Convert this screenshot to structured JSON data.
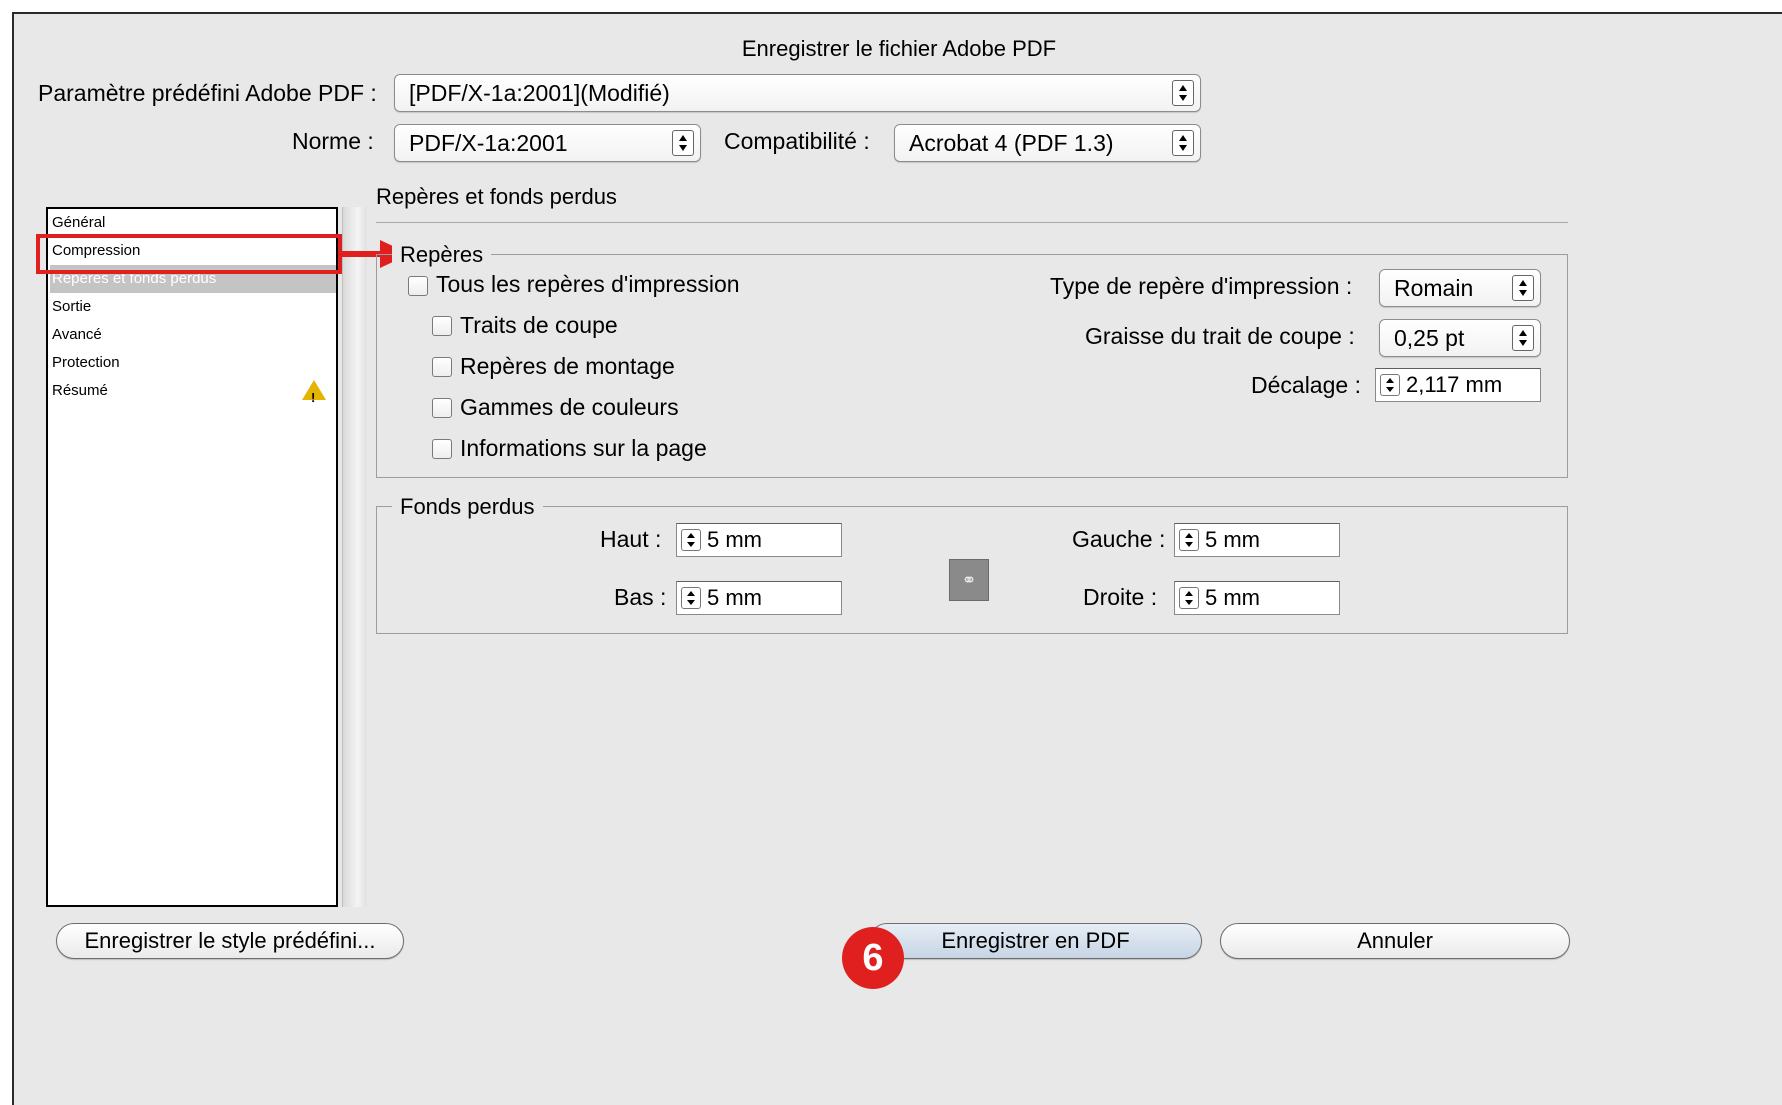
{
  "dialog": {
    "title": "Enregistrer le fichier Adobe PDF"
  },
  "preset": {
    "label": "Paramètre prédéfini Adobe PDF :",
    "value": "[PDF/X-1a:2001](Modifié)"
  },
  "standard": {
    "label": "Norme :",
    "value": "PDF/X-1a:2001"
  },
  "compatibility": {
    "label": "Compatibilité :",
    "value": "Acrobat 4 (PDF 1.3)"
  },
  "sidebar": {
    "items": [
      {
        "label": "Général"
      },
      {
        "label": "Compression"
      },
      {
        "label": "Repères et fonds perdus",
        "selected": true
      },
      {
        "label": "Sortie"
      },
      {
        "label": "Avancé"
      },
      {
        "label": "Protection"
      },
      {
        "label": "Résumé",
        "warning_icon": "warning-triangle-icon"
      }
    ]
  },
  "panel": {
    "title": "Repères et fonds perdus"
  },
  "marks": {
    "group_title": "Repères",
    "all_marks": {
      "label": "Tous les repères d'impression",
      "checked": false
    },
    "options": [
      {
        "label": "Traits de coupe",
        "checked": false
      },
      {
        "label": "Repères de montage",
        "checked": false
      },
      {
        "label": "Gammes de couleurs",
        "checked": false
      },
      {
        "label": "Informations sur la page",
        "checked": false
      }
    ],
    "type_label": "Type de repère d'impression :",
    "type_value": "Romain",
    "weight_label": "Graisse du trait de coupe :",
    "weight_value": "0,25 pt",
    "offset_label": "Décalage :",
    "offset_value": "2,117 mm"
  },
  "bleed": {
    "group_title": "Fonds perdus",
    "top_label": "Haut :",
    "top_value": "5 mm",
    "bottom_label": "Bas :",
    "bottom_value": "5 mm",
    "left_label": "Gauche :",
    "left_value": "5 mm",
    "right_label": "Droite :",
    "right_value": "5 mm",
    "link_icon": "chain-link-icon"
  },
  "buttons": {
    "save_preset": "Enregistrer le style prédéfini...",
    "save_pdf": "Enregistrer en PDF",
    "cancel": "Annuler"
  },
  "annotation": {
    "step_number": "6",
    "color": "#e0201f"
  }
}
